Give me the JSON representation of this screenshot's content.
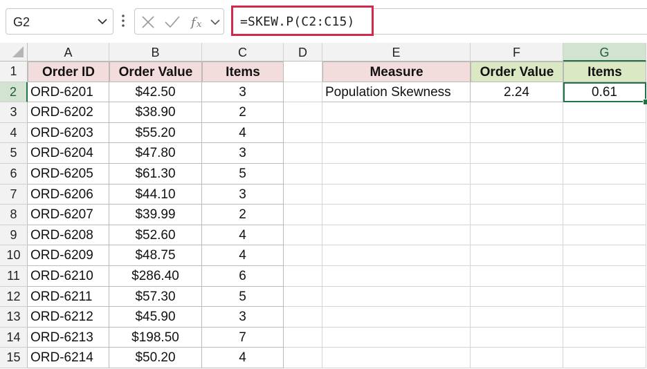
{
  "name_box": {
    "value": "G2"
  },
  "formula_bar": {
    "formula": "=SKEW.P(C2:C15)"
  },
  "icons": {
    "cancel": "x-icon",
    "enter": "check-icon",
    "function": "fx-icon",
    "dropdown": "chevron-down-icon"
  },
  "columns": [
    "A",
    "B",
    "C",
    "D",
    "E",
    "F",
    "G"
  ],
  "rows": [
    "1",
    "2",
    "3",
    "4",
    "5",
    "6",
    "7",
    "8",
    "9",
    "10",
    "11",
    "12",
    "13",
    "14",
    "15"
  ],
  "selected": {
    "column": "G",
    "row": "2"
  },
  "table": {
    "headers": [
      "Order ID",
      "Order Value",
      "Items"
    ],
    "rows": [
      [
        "ORD-6201",
        "$42.50",
        "3"
      ],
      [
        "ORD-6202",
        "$38.90",
        "2"
      ],
      [
        "ORD-6203",
        "$55.20",
        "4"
      ],
      [
        "ORD-6204",
        "$47.80",
        "3"
      ],
      [
        "ORD-6205",
        "$61.30",
        "5"
      ],
      [
        "ORD-6206",
        "$44.10",
        "3"
      ],
      [
        "ORD-6207",
        "$39.99",
        "2"
      ],
      [
        "ORD-6208",
        "$52.60",
        "4"
      ],
      [
        "ORD-6209",
        "$48.75",
        "4"
      ],
      [
        "ORD-6210",
        "$286.40",
        "6"
      ],
      [
        "ORD-6211",
        "$57.30",
        "5"
      ],
      [
        "ORD-6212",
        "$45.90",
        "3"
      ],
      [
        "ORD-6213",
        "$198.50",
        "7"
      ],
      [
        "ORD-6214",
        "$50.20",
        "4"
      ]
    ]
  },
  "result_table": {
    "headers": [
      "Measure",
      "Order Value",
      "Items"
    ],
    "row": [
      "Population Skewness",
      "2.24",
      "0.61"
    ]
  },
  "colors": {
    "accent": "#217346",
    "formula_highlight": "#d3284b",
    "header_pink": "#f3dcdc",
    "header_green": "#dbe8c4"
  }
}
